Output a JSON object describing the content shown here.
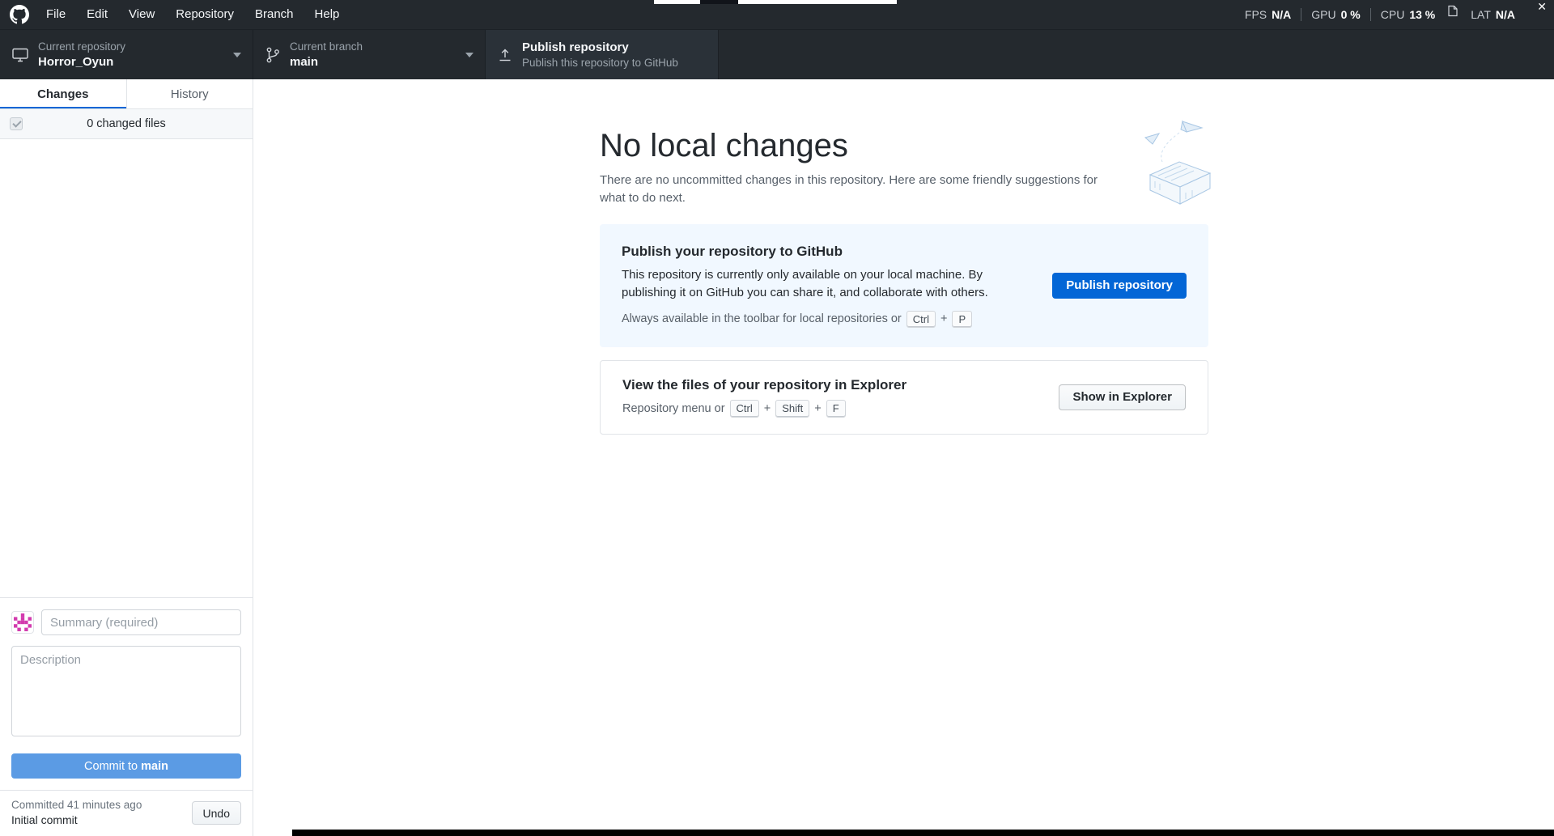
{
  "window": {
    "close_icon": "✕"
  },
  "menu_bar": {
    "items": [
      "File",
      "Edit",
      "View",
      "Repository",
      "Branch",
      "Help"
    ],
    "stats": [
      {
        "label": "FPS",
        "value": "N/A"
      },
      {
        "label": "GPU",
        "value": "0 %"
      },
      {
        "label": "CPU",
        "value": "13 %"
      },
      {
        "label": "LAT",
        "value": "N/A"
      }
    ]
  },
  "toolbar": {
    "repository": {
      "label": "Current repository",
      "value": "Horror_Oyun"
    },
    "branch": {
      "label": "Current branch",
      "value": "main"
    },
    "publish": {
      "title": "Publish repository",
      "subtitle": "Publish this repository to GitHub"
    }
  },
  "sidebar": {
    "tabs": [
      {
        "label": "Changes"
      },
      {
        "label": "History"
      }
    ],
    "changed_files_label": "0 changed files",
    "commit": {
      "summary_placeholder": "Summary (required)",
      "description_placeholder": "Description",
      "button_prefix": "Commit to ",
      "branch": "main"
    },
    "last_commit": {
      "time": "Committed 41 minutes ago",
      "message": "Initial commit",
      "undo_label": "Undo"
    }
  },
  "main": {
    "title": "No local changes",
    "subtitle": "There are no uncommitted changes in this repository. Here are some friendly suggestions for what to do next.",
    "kbd_plus": "+",
    "cards": [
      {
        "title": "Publish your repository to GitHub",
        "body": "This repository is currently only available on your local machine. By publishing it on GitHub you can share it, and collaborate with others.",
        "hint_prefix": "Always available in the toolbar for local repositories or",
        "keys": [
          "Ctrl",
          "P"
        ],
        "button": "Publish repository"
      },
      {
        "title": "View the files of your repository in Explorer",
        "hint_prefix": "Repository menu or",
        "keys": [
          "Ctrl",
          "Shift",
          "F"
        ],
        "button": "Show in Explorer"
      }
    ]
  },
  "colors": {
    "accent": "#0366d6",
    "header_bg": "#24292e",
    "card_blue_bg": "#f1f8ff",
    "commit_disabled_blue": "#5b9be4",
    "avatar_pink": "#d23bae"
  }
}
